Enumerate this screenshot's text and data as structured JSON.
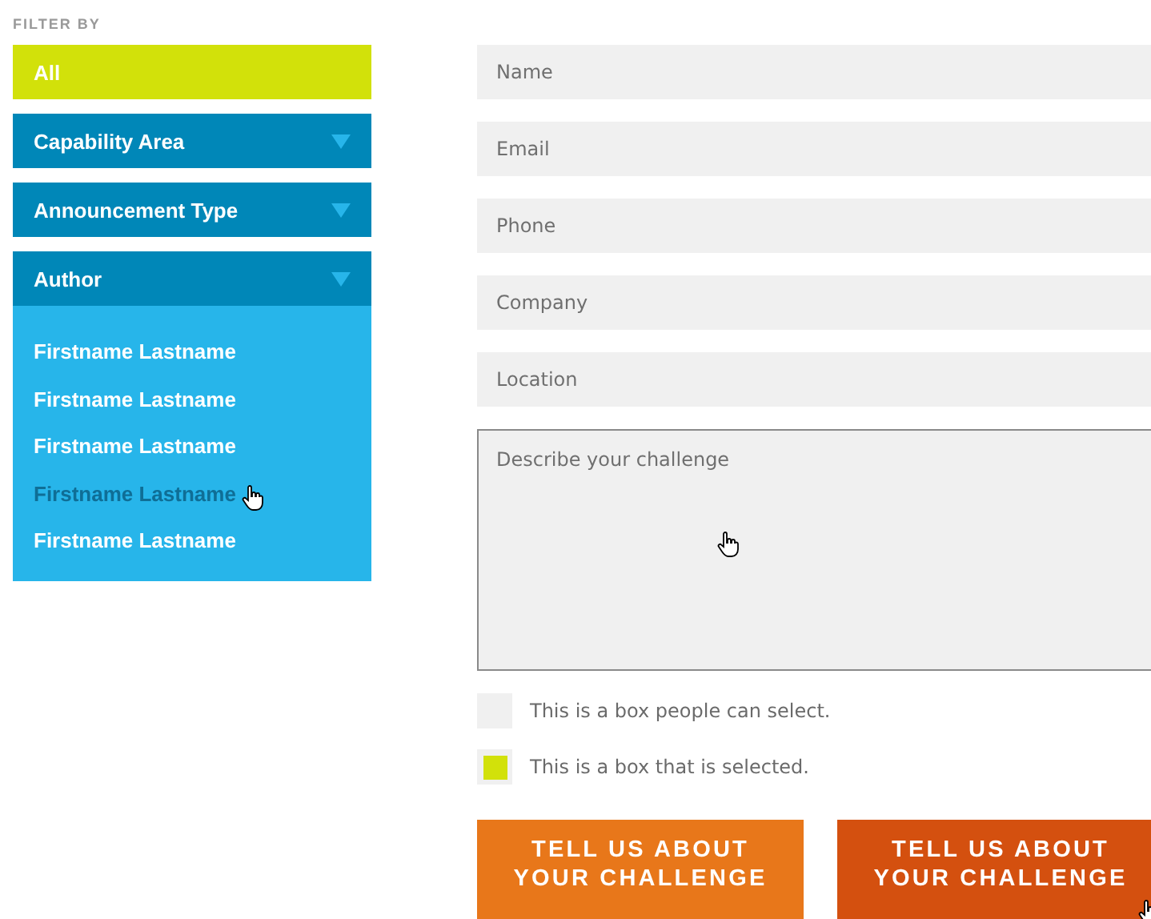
{
  "filter_label": "FILTER BY",
  "filters": [
    {
      "label": "All",
      "kind": "plain",
      "selected": true
    },
    {
      "label": "Capability Area",
      "kind": "dropdown",
      "selected": false
    },
    {
      "label": "Announcement Type",
      "kind": "dropdown",
      "selected": false
    },
    {
      "label": "Author",
      "kind": "dropdown",
      "selected": false,
      "options": [
        {
          "label": "Firstname Lastname",
          "hovered": false
        },
        {
          "label": "Firstname Lastname",
          "hovered": false
        },
        {
          "label": "Firstname Lastname",
          "hovered": false
        },
        {
          "label": "Firstname Lastname",
          "hovered": true
        },
        {
          "label": "Firstname Lastname",
          "hovered": false
        }
      ]
    }
  ],
  "form": {
    "fields": [
      {
        "kind": "input",
        "placeholder": "Name"
      },
      {
        "kind": "input",
        "placeholder": "Email"
      },
      {
        "kind": "input",
        "placeholder": "Phone"
      },
      {
        "kind": "input",
        "placeholder": "Company"
      },
      {
        "kind": "input",
        "placeholder": "Location"
      },
      {
        "kind": "textarea",
        "placeholder": "Describe your challenge"
      }
    ],
    "checkboxes": [
      {
        "label": "This is a box people can select.",
        "checked": false
      },
      {
        "label": "This is a box that is selected.",
        "checked": true
      }
    ],
    "buttons": [
      {
        "label": "TELL US ABOUT YOUR CHALLENGE",
        "hovered": false
      },
      {
        "label": "TELL US ABOUT YOUR CHALLENGE",
        "hovered": true
      }
    ]
  }
}
